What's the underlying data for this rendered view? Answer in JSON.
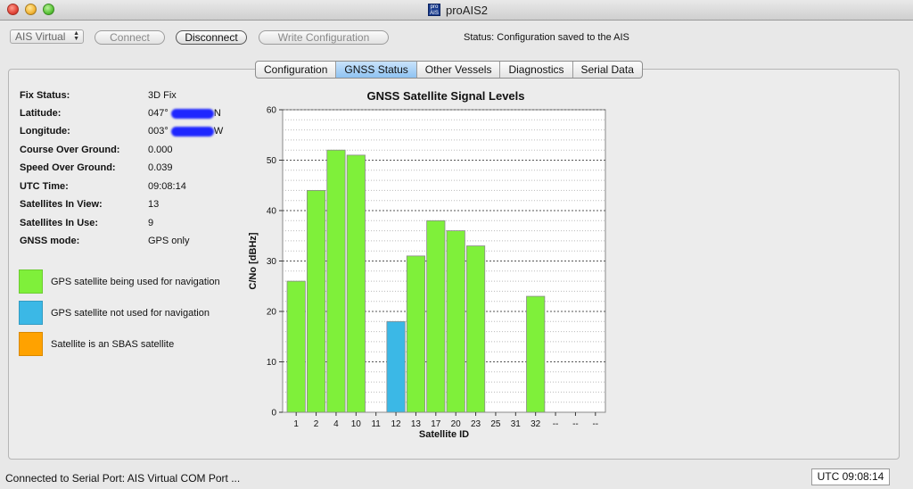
{
  "window": {
    "title": "proAIS2",
    "icon_text": "pro AIS"
  },
  "toolbar": {
    "port_select": "AIS Virtual",
    "connect_label": "Connect",
    "disconnect_label": "Disconnect",
    "write_label": "Write Configuration",
    "status": "Status: Configuration saved to the AIS"
  },
  "tabs": [
    {
      "label": "Configuration",
      "active": false
    },
    {
      "label": "GNSS Status",
      "active": true
    },
    {
      "label": "Other Vessels",
      "active": false
    },
    {
      "label": "Diagnostics",
      "active": false
    },
    {
      "label": "Serial Data",
      "active": false
    }
  ],
  "gnss_info": [
    {
      "label": "Fix Status:",
      "value": "3D Fix"
    },
    {
      "label": "Latitude:",
      "value": "047°",
      "suffix": "N",
      "redacted": true
    },
    {
      "label": "Longitude:",
      "value": "003°",
      "suffix": "W",
      "redacted": true
    },
    {
      "label": "Course Over Ground:",
      "value": "0.000"
    },
    {
      "label": "Speed Over Ground:",
      "value": "0.039"
    },
    {
      "label": "UTC Time:",
      "value": "09:08:14"
    },
    {
      "label": "Satellites In View:",
      "value": "13"
    },
    {
      "label": "Satellites In Use:",
      "value": "9"
    },
    {
      "label": "GNSS mode:",
      "value": "GPS only"
    }
  ],
  "legend": [
    {
      "label": "GPS satellite being used for navigation",
      "color": "#7ff03a"
    },
    {
      "label": "GPS satellite not used for navigation",
      "color": "#3bb8e6"
    },
    {
      "label": "Satellite is an SBAS satellite",
      "color": "#ffa200"
    }
  ],
  "colors": {
    "used": "#7ff03a",
    "not_used": "#3bb8e6",
    "sbas": "#ffa200"
  },
  "chart_data": {
    "type": "bar",
    "title": "GNSS Satellite Signal Levels",
    "xlabel": "Satellite ID",
    "ylabel": "C/No [dBHz]",
    "ylim": [
      0,
      60
    ],
    "yticks": [
      0,
      10,
      20,
      30,
      40,
      50,
      60
    ],
    "grid": true,
    "categories": [
      "1",
      "2",
      "4",
      "10",
      "11",
      "12",
      "13",
      "17",
      "20",
      "23",
      "25",
      "31",
      "32",
      "--",
      "--",
      "--"
    ],
    "values": [
      26,
      44,
      52,
      51,
      0,
      18,
      31,
      38,
      36,
      33,
      0,
      0,
      23,
      0,
      0,
      0
    ],
    "status": [
      "used",
      "used",
      "used",
      "used",
      "none",
      "not_used",
      "used",
      "used",
      "used",
      "used",
      "none",
      "none",
      "used",
      "none",
      "none",
      "none"
    ]
  },
  "footer": {
    "connection": "Connected to Serial Port: AIS Virtual COM Port ...",
    "utc": "UTC  09:08:14"
  }
}
